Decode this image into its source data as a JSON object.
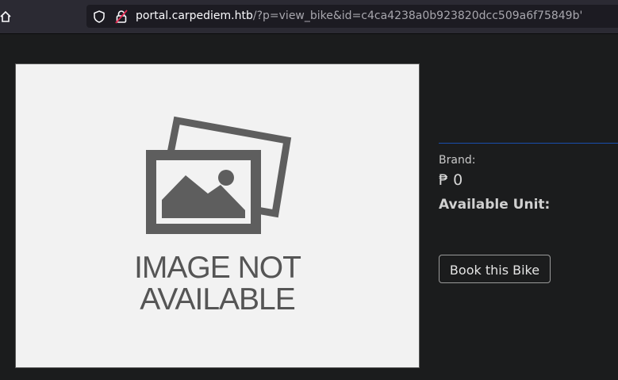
{
  "browser": {
    "url_host": "portal.carpediem.htb",
    "url_path": "/?p=view_bike&id=c4ca4238a0b923820dcc509a6f75849b'",
    "icons": [
      "home-icon",
      "shield-icon",
      "insecure-lock-icon"
    ]
  },
  "product": {
    "image_placeholder": {
      "line1": "IMAGE NOT",
      "line2": "AVAILABLE",
      "icon": "photo-icon"
    },
    "brand_label": "Brand:",
    "price": "₱ 0",
    "available_unit_label": "Available Unit:",
    "book_button": "Book this Bike"
  },
  "colors": {
    "background": "#1b1c1d",
    "divider": "#1a4fae",
    "placeholder_bg": "#f2f2f2",
    "placeholder_fg": "#555555"
  }
}
